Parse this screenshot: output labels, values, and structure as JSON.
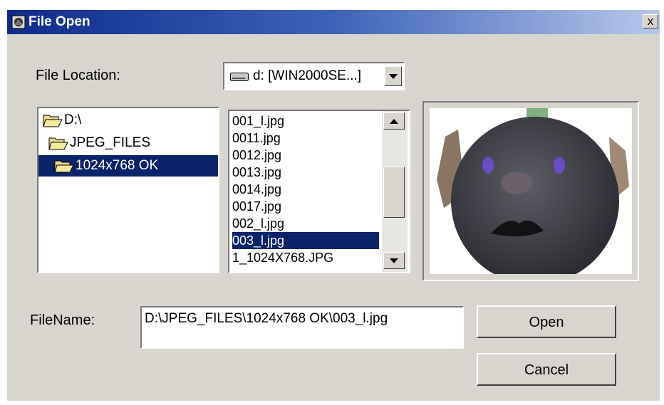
{
  "window": {
    "title": "File Open",
    "close_label": "x"
  },
  "location": {
    "label": "File Location:",
    "selected": "d: [WIN2000SE...]"
  },
  "folder_tree": [
    {
      "label": "D:\\",
      "selected": false
    },
    {
      "label": "JPEG_FILES",
      "selected": false
    },
    {
      "label": "1024x768 OK",
      "selected": true
    }
  ],
  "files": [
    {
      "label": "001_l.jpg",
      "selected": false
    },
    {
      "label": "0011.jpg",
      "selected": false
    },
    {
      "label": "0012.jpg",
      "selected": false
    },
    {
      "label": "0013.jpg",
      "selected": false
    },
    {
      "label": "0014.jpg",
      "selected": false
    },
    {
      "label": "0017.jpg",
      "selected": false
    },
    {
      "label": "002_l.jpg",
      "selected": false
    },
    {
      "label": "003_l.jpg",
      "selected": true
    },
    {
      "label": "1_1024X768.JPG",
      "selected": false
    }
  ],
  "filename": {
    "label": "FileName:",
    "value": "D:\\JPEG_FILES\\1024x768 OK\\003_l.jpg"
  },
  "buttons": {
    "open": "Open",
    "cancel": "Cancel"
  },
  "colors": {
    "selection": "#0a246a",
    "titlebar_start": "#102a8c",
    "dialog_bg": "#d8d5cf"
  }
}
